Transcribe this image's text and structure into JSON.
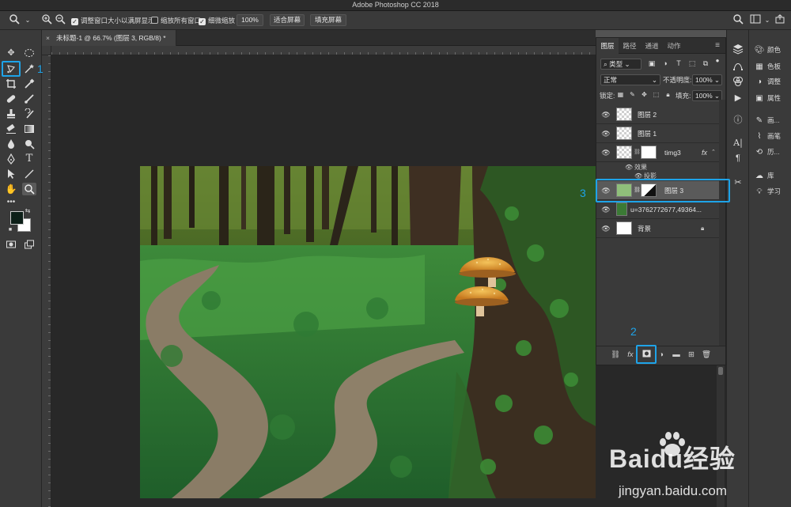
{
  "app": {
    "title": "Adobe Photoshop CC 2018"
  },
  "options_bar": {
    "resize_windows_label": "调整窗口大小以满屏显示",
    "zoom_all_label": "缩放所有窗口",
    "scrubby_zoom_label": "细微缩放",
    "zoom_percent": "100%",
    "fit_screen_button": "适合屏幕",
    "fill_screen_button": "填充屏幕",
    "resize_windows_checked": true,
    "zoom_all_checked": false,
    "scrubby_zoom_checked": true
  },
  "document": {
    "tab_title": "未标题-1 @ 66.7% (图层 3, RGB/8) *"
  },
  "layers_panel": {
    "tabs": [
      "图层",
      "路径",
      "通道",
      "动作"
    ],
    "active_tab": "图层",
    "filter_kind": "类型",
    "blend_mode": "正常",
    "opacity_label": "不透明度:",
    "opacity_value": "100%",
    "lock_label": "锁定:",
    "fill_label": "填充:",
    "fill_value": "100%",
    "layers": [
      {
        "name": "图层 2",
        "visible": true
      },
      {
        "name": "图层 1",
        "visible": true
      },
      {
        "name": "timg3",
        "visible": true,
        "has_mask": true,
        "has_fx": true,
        "fx_label": "fx"
      },
      {
        "name": "图层 3",
        "visible": true,
        "has_mask": true,
        "selected": true
      },
      {
        "name": "u=3762772677,49364...",
        "visible": true
      },
      {
        "name": "背景",
        "visible": true,
        "locked": true
      }
    ],
    "effects_label": "效果",
    "effect_item": "投影"
  },
  "right_panels": {
    "items": [
      "颜色",
      "色板",
      "调整",
      "属性",
      "画...",
      "画笔",
      "历...",
      "库",
      "学习"
    ]
  },
  "annotations": {
    "one": "1",
    "two": "2",
    "three": "3"
  },
  "watermark": {
    "main": "Baidu经验",
    "sub": "jingyan.baidu.com"
  },
  "colors": {
    "annotation": "#1ea3e8",
    "panel": "#3a3a3a",
    "workspace": "#282828"
  }
}
